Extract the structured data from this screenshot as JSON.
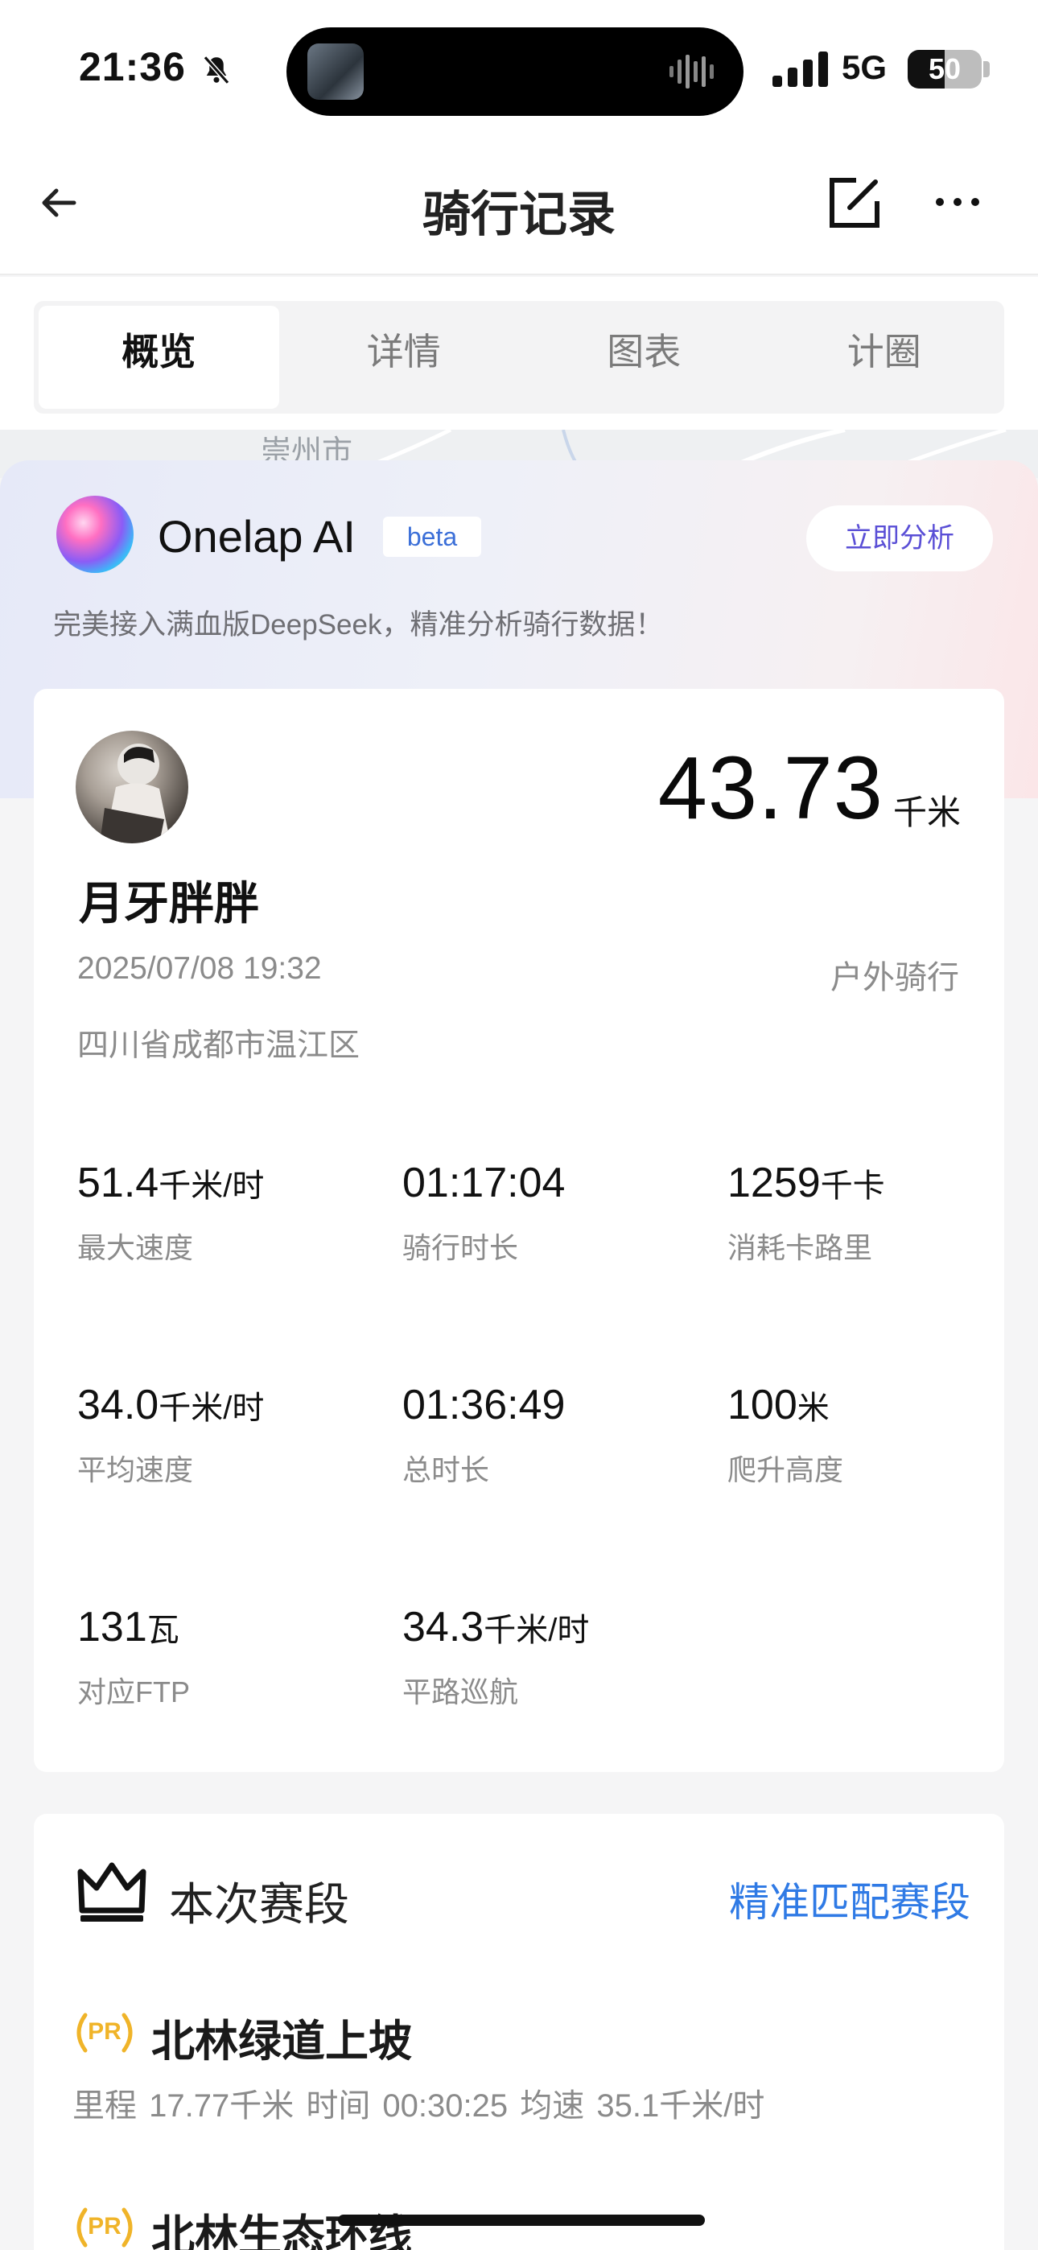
{
  "status": {
    "time": "21:36",
    "network": "5G",
    "battery": "50",
    "battery_level": 0.5
  },
  "nav": {
    "title": "骑行记录"
  },
  "tabs": [
    "概览",
    "详情",
    "图表",
    "计圈"
  ],
  "map": {
    "label": "崇州市"
  },
  "ai": {
    "name": "Onelap AI",
    "badge": "beta",
    "button": "立即分析",
    "subtitle": "完美接入满血版DeepSeek，精准分析骑行数据！"
  },
  "ride": {
    "distance": "43.73",
    "distance_unit": "千米",
    "rider": "月牙胖胖",
    "datetime": "2025/07/08 19:32",
    "type": "户外骑行",
    "location": "四川省成都市温江区",
    "stats": [
      {
        "value": "51.4",
        "unit": "千米/时",
        "label": "最大速度"
      },
      {
        "value": "01:17:04",
        "unit": "",
        "label": "骑行时长"
      },
      {
        "value": "1259",
        "unit": "千卡",
        "label": "消耗卡路里"
      },
      {
        "value": "34.0",
        "unit": "千米/时",
        "label": "平均速度"
      },
      {
        "value": "01:36:49",
        "unit": "",
        "label": "总时长"
      },
      {
        "value": "100",
        "unit": "米",
        "label": "爬升高度"
      },
      {
        "value": "131",
        "unit": "瓦",
        "label": "对应FTP"
      },
      {
        "value": "34.3",
        "unit": "千米/时",
        "label": "平路巡航"
      }
    ]
  },
  "segments": {
    "title": "本次赛段",
    "link": "精准匹配赛段",
    "badge": "PR",
    "items": [
      {
        "name": "北林绿道上坡",
        "meta": "里程 17.77千米   时间 00:30:25   均速 35.1千米/时"
      },
      {
        "name": "北林生态环线",
        "meta": ""
      }
    ]
  }
}
